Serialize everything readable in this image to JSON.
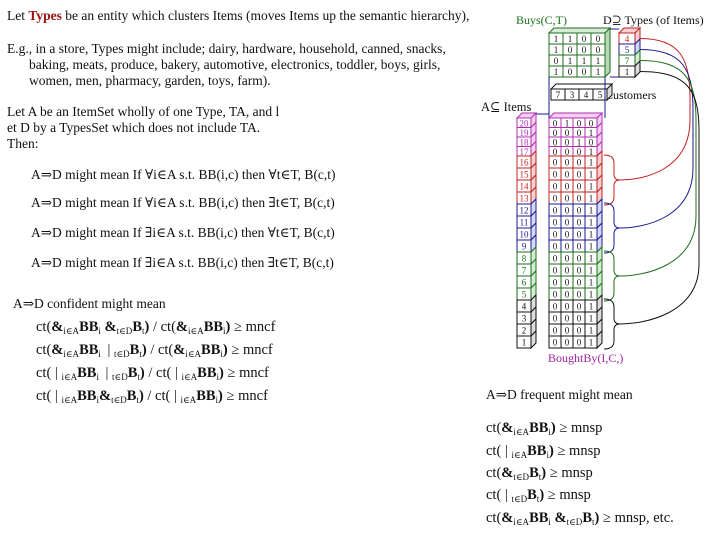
{
  "intro": {
    "line1_pre": "Let ",
    "line1_types": "Types",
    "line1_post": " be an entity which clusters Items (moves Items up the semantic hierarchy),",
    "eg_lines": [
      "E.g., in a store, Types might include; dairy, hardware, household, canned, snacks,",
      "baking, meats, produce, bakery, automotive, electronics, toddler, boys, girls,",
      "women, men, pharmacy, garden, toys, farm)."
    ],
    "let_lines": [
      "Let A be an ItemSet wholly of one Type, TA, and l",
      "et D by a TypesSet which does not include TA.",
      "Then:"
    ]
  },
  "meanings": [
    "A⇒D might mean If ∀i∈A s.t. BB(i,c) then ∀t∈T, B(c,t)",
    "A⇒D might mean If ∀i∈A s.t. BB(i,c) then ∃t∈T, B(c,t)",
    "A⇒D might mean If ∃i∈A s.t. BB(i,c) then ∀t∈T, B(c,t)",
    "A⇒D might mean If ∃i∈A s.t. BB(i,c) then ∃t∈T, B(c,t)"
  ],
  "confident": {
    "heading": "A⇒D confident might mean",
    "threshold": "mncf"
  },
  "frequent": {
    "heading": "A⇒D frequent might mean",
    "threshold": "mnsp",
    "etc": ", etc."
  },
  "diagram": {
    "buys_label": "Buys(C,T)",
    "types_label": "D⊇ Types (of Items)",
    "customers_label": "Customers",
    "items_label": "A⊆ Items",
    "boughtby_label": "BoughtBy(I,C,)",
    "buys_matrix": [
      [
        1,
        1,
        0,
        0
      ],
      [
        1,
        0,
        0,
        0
      ],
      [
        0,
        1,
        1,
        1
      ],
      [
        1,
        0,
        0,
        1
      ]
    ],
    "types_values": [
      "4",
      "5",
      "7",
      "1"
    ],
    "customers_values": [
      "7",
      "3",
      "4",
      "5"
    ],
    "item_labels": [
      "20",
      "19",
      "18",
      "17",
      "16",
      "15",
      "14",
      "13",
      "12",
      "11",
      "10",
      "9",
      "8",
      "7",
      "6",
      "5",
      "4",
      "3",
      "2",
      "1"
    ],
    "boughtby_matrix": [
      [
        0,
        1,
        0,
        0
      ],
      [
        0,
        0,
        0,
        1
      ],
      [
        0,
        0,
        1,
        0
      ],
      [
        0,
        0,
        0,
        1
      ],
      [
        0,
        0,
        0,
        1
      ],
      [
        0,
        0,
        0,
        1
      ],
      [
        0,
        0,
        0,
        1
      ],
      [
        0,
        0,
        0,
        1
      ],
      [
        0,
        0,
        0,
        1
      ],
      [
        0,
        0,
        0,
        1
      ],
      [
        0,
        0,
        0,
        1
      ],
      [
        0,
        0,
        0,
        1
      ],
      [
        0,
        0,
        0,
        1
      ],
      [
        0,
        0,
        0,
        1
      ],
      [
        0,
        0,
        0,
        1
      ],
      [
        0,
        0,
        0,
        1
      ],
      [
        0,
        0,
        0,
        1
      ],
      [
        0,
        0,
        0,
        1
      ],
      [
        0,
        0,
        0,
        1
      ],
      [
        0,
        0,
        0,
        1
      ]
    ],
    "group_colors": [
      "#b030b0",
      "#c02020",
      "#1a1a90",
      "#1e6e1e",
      "#111111"
    ],
    "group_fills": [
      "#f4d0f4",
      "#f6d0d0",
      "#d4d8f4",
      "#d4ecd4",
      "#dddddd"
    ],
    "buys_color": "#1e6e1e",
    "boughtby_color": "#a020a0"
  }
}
